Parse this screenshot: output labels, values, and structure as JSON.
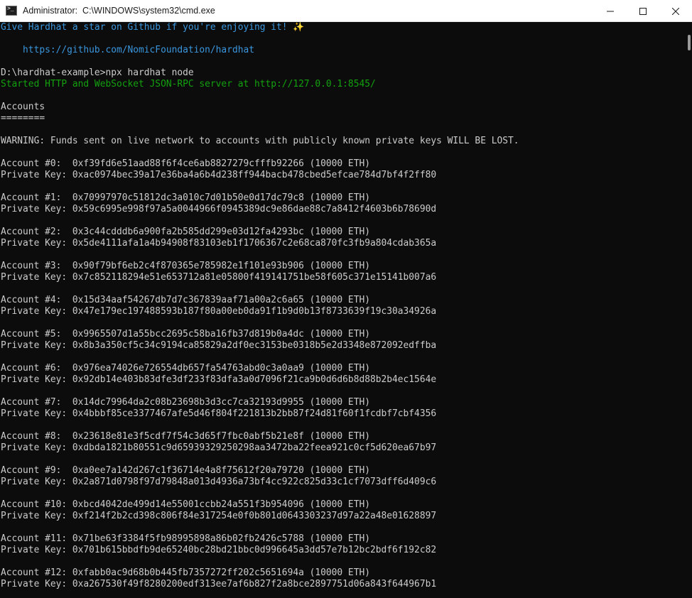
{
  "window": {
    "title": "Administrator:  C:\\WINDOWS\\system32\\cmd.exe",
    "icon": "cmd-icon"
  },
  "terminal": {
    "star_line": "Give Hardhat a star on Github if you're enjoying it! ✨",
    "github_url": "    https://github.com/NomicFoundation/hardhat",
    "prompt": "D:\\hardhat-example>npx hardhat node",
    "server_started": "Started HTTP and WebSocket JSON-RPC server at http://127.0.0.1:8545/",
    "accounts_heading": "Accounts",
    "accounts_underline": "========",
    "warning": "WARNING: Funds sent on live network to accounts with publicly known private keys WILL BE LOST.",
    "accounts": [
      {
        "label": "Account #0:  0xf39fd6e51aad88f6f4ce6ab8827279cfffb92266 (10000 ETH)",
        "key": "Private Key: 0xac0974bec39a17e36ba4a6b4d238ff944bacb478cbed5efcae784d7bf4f2ff80"
      },
      {
        "label": "Account #1:  0x70997970c51812dc3a010c7d01b50e0d17dc79c8 (10000 ETH)",
        "key": "Private Key: 0x59c6995e998f97a5a0044966f0945389dc9e86dae88c7a8412f4603b6b78690d"
      },
      {
        "label": "Account #2:  0x3c44cdddb6a900fa2b585dd299e03d12fa4293bc (10000 ETH)",
        "key": "Private Key: 0x5de4111afa1a4b94908f83103eb1f1706367c2e68ca870fc3fb9a804cdab365a"
      },
      {
        "label": "Account #3:  0x90f79bf6eb2c4f870365e785982e1f101e93b906 (10000 ETH)",
        "key": "Private Key: 0x7c852118294e51e653712a81e05800f419141751be58f605c371e15141b007a6"
      },
      {
        "label": "Account #4:  0x15d34aaf54267db7d7c367839aaf71a00a2c6a65 (10000 ETH)",
        "key": "Private Key: 0x47e179ec197488593b187f80a00eb0da91f1b9d0b13f8733639f19c30a34926a"
      },
      {
        "label": "Account #5:  0x9965507d1a55bcc2695c58ba16fb37d819b0a4dc (10000 ETH)",
        "key": "Private Key: 0x8b3a350cf5c34c9194ca85829a2df0ec3153be0318b5e2d3348e872092edffba"
      },
      {
        "label": "Account #6:  0x976ea74026e726554db657fa54763abd0c3a0aa9 (10000 ETH)",
        "key": "Private Key: 0x92db14e403b83dfe3df233f83dfa3a0d7096f21ca9b0d6d6b8d88b2b4ec1564e"
      },
      {
        "label": "Account #7:  0x14dc79964da2c08b23698b3d3cc7ca32193d9955 (10000 ETH)",
        "key": "Private Key: 0x4bbbf85ce3377467afe5d46f804f221813b2bb87f24d81f60f1fcdbf7cbf4356"
      },
      {
        "label": "Account #8:  0x23618e81e3f5cdf7f54c3d65f7fbc0abf5b21e8f (10000 ETH)",
        "key": "Private Key: 0xdbda1821b80551c9d65939329250298aa3472ba22feea921c0cf5d620ea67b97"
      },
      {
        "label": "Account #9:  0xa0ee7a142d267c1f36714e4a8f75612f20a79720 (10000 ETH)",
        "key": "Private Key: 0x2a871d0798f97d79848a013d4936a73bf4cc922c825d33c1cf7073dff6d409c6"
      },
      {
        "label": "Account #10: 0xbcd4042de499d14e55001ccbb24a551f3b954096 (10000 ETH)",
        "key": "Private Key: 0xf214f2b2cd398c806f84e317254e0f0b801d0643303237d97a22a48e01628897"
      },
      {
        "label": "Account #11: 0x71be63f3384f5fb98995898a86b02fb2426c5788 (10000 ETH)",
        "key": "Private Key: 0x701b615bbdfb9de65240bc28bd21bbc0d996645a3dd57e7b12bc2bdf6f192c82"
      },
      {
        "label": "Account #12: 0xfabb0ac9d68b0b445fb7357272ff202c5651694a (10000 ETH)",
        "key": "Private Key: 0xa267530f49f8280200edf313ee7af6b827f2a8bce2897751d06a843f644967b1"
      }
    ]
  },
  "colors": {
    "background": "#0c0c0c",
    "text": "#cccccc",
    "info_blue": "#3a96dd",
    "success_green": "#13a10e"
  }
}
